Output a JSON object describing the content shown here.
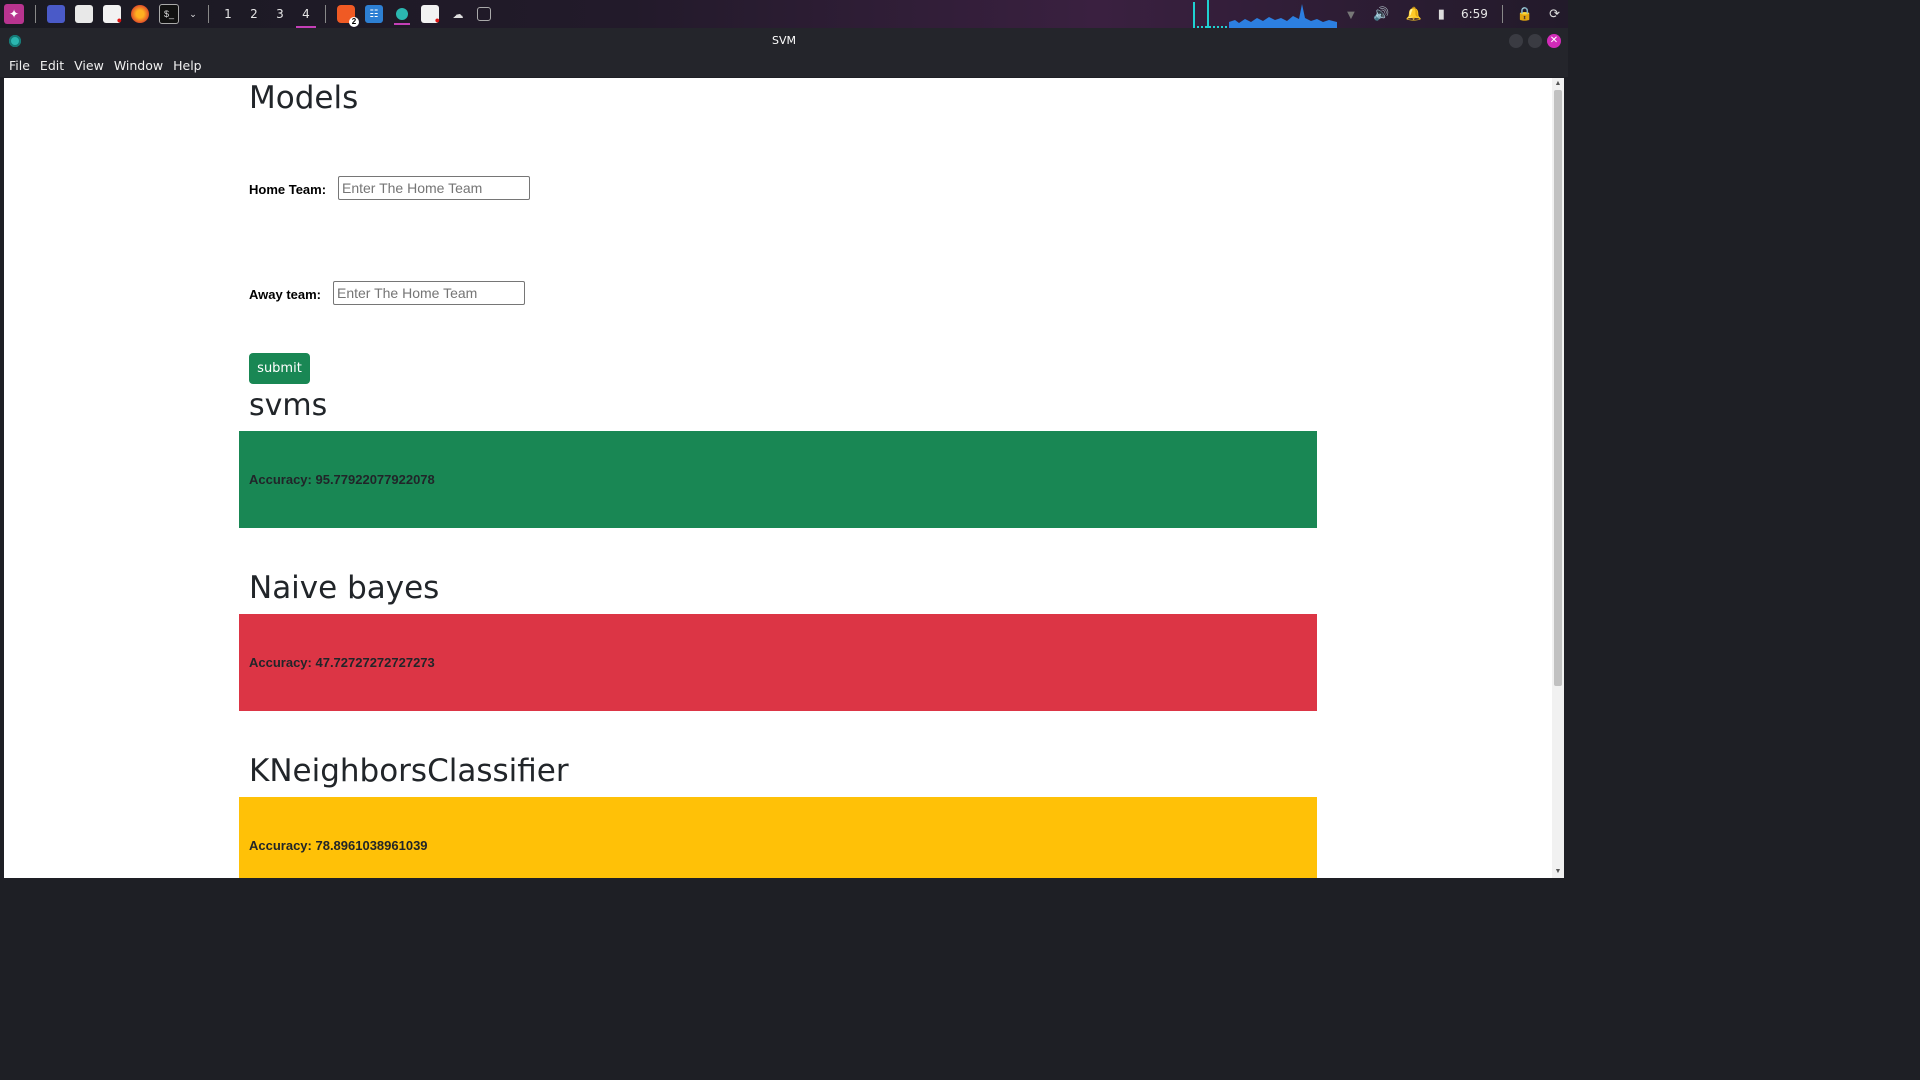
{
  "taskbar": {
    "workspaces": [
      "1",
      "2",
      "3",
      "4"
    ],
    "active_workspace": "4",
    "brave_badge": "2",
    "clock": "6:59"
  },
  "window": {
    "title": "SVM"
  },
  "menu": [
    "File",
    "Edit",
    "View",
    "Window",
    "Help"
  ],
  "page": {
    "heading": "Models",
    "home_label": "Home Team:",
    "home_placeholder": "Enter The Home Team",
    "away_label": "Away team:",
    "away_placeholder": "Enter The Home Team",
    "submit_label": "submit",
    "models": [
      {
        "name": "svms",
        "accuracy": "Accuracy: 95.77922077922078",
        "color": "#198754"
      },
      {
        "name": "Naive bayes",
        "accuracy": "Accuracy: 47.72727272727273",
        "color": "#dc3545"
      },
      {
        "name": "KNeighborsClassifier",
        "accuracy": "Accuracy: 78.8961038961039",
        "color": "#ffc107"
      }
    ]
  },
  "colors": {
    "success": "#198754",
    "danger": "#dc3545",
    "warning": "#ffc107",
    "accent": "#c43fb7"
  }
}
